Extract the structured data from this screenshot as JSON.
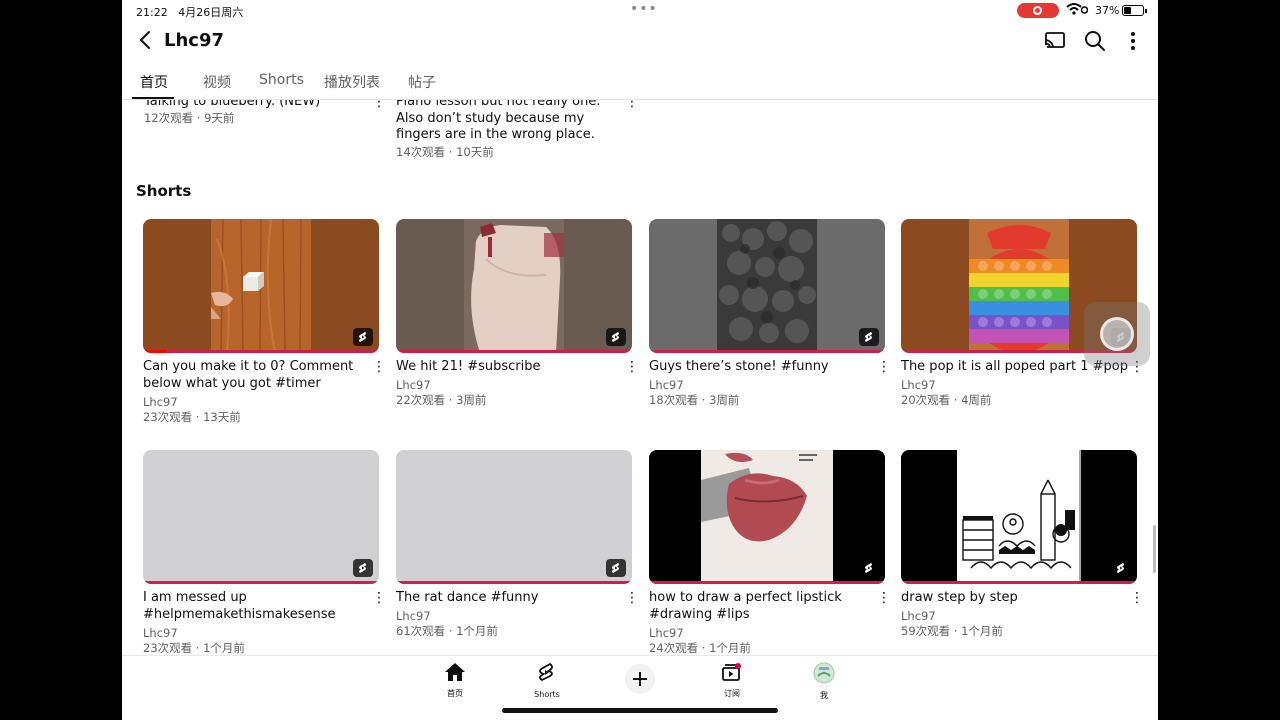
{
  "status_bar": {
    "time": "21:22",
    "date": "4月26日周六",
    "battery": "37%"
  },
  "header": {
    "title": "Lhc97"
  },
  "tabs": [
    {
      "label": "首页",
      "active": true
    },
    {
      "label": "视频"
    },
    {
      "label": "Shorts"
    },
    {
      "label": "播放列表"
    },
    {
      "label": "帖子"
    }
  ],
  "top_videos": [
    {
      "title": "Talking to blueberry. (NEW)",
      "meta": "12次观看 · 9天前"
    },
    {
      "title_lines": [
        "Piano lesson but not really one.",
        "Also don’t study because my",
        "fingers are in the wrong place."
      ],
      "meta": "14次观看 · 10天前"
    }
  ],
  "shorts_section": {
    "title": "Shorts"
  },
  "shorts": [
    {
      "title_lines": [
        "Can you make it to 0? Comment",
        "below what you got #timer"
      ],
      "channel": "Lhc97",
      "meta": "23次观看 · 13天前",
      "progress": 0.1
    },
    {
      "title_lines": [
        "We hit 21! #subscribe"
      ],
      "channel": "Lhc97",
      "meta": "22次观看 · 3周前"
    },
    {
      "title_lines": [
        "Guys there’s stone! #funny"
      ],
      "channel": "Lhc97",
      "meta": "18次观看 · 3周前"
    },
    {
      "title_lines": [
        "The pop it is all poped part 1 #pop"
      ],
      "channel": "Lhc97",
      "meta": "20次观看 · 4周前"
    },
    {
      "title_lines": [
        "I am messed up",
        "#helpmemakethismakesense"
      ],
      "channel": "Lhc97",
      "meta": "23次观看 · 1个月前"
    },
    {
      "title_lines": [
        "The rat dance #funny"
      ],
      "channel": "Lhc97",
      "meta": "61次观看 · 1个月前"
    },
    {
      "title_lines": [
        "how to draw a perfect lipstick",
        "#drawing #lips"
      ],
      "channel": "Lhc97",
      "meta": "24次观看 · 1个月前"
    },
    {
      "title_lines": [
        "draw step by step"
      ],
      "channel": "Lhc97",
      "meta": "59次观看 · 1个月前"
    }
  ],
  "bottom_nav": [
    {
      "label": "首页",
      "icon": "home-icon"
    },
    {
      "label": "Shorts",
      "icon": "shorts-icon"
    },
    {
      "label": "",
      "icon": "create-plus-icon"
    },
    {
      "label": "订阅",
      "icon": "subscriptions-icon"
    },
    {
      "label": "我",
      "icon": "avatar"
    }
  ],
  "colors": {
    "accent": "#ff0000",
    "progress_track": "#cc1f4c",
    "text_secondary": "#606060"
  }
}
